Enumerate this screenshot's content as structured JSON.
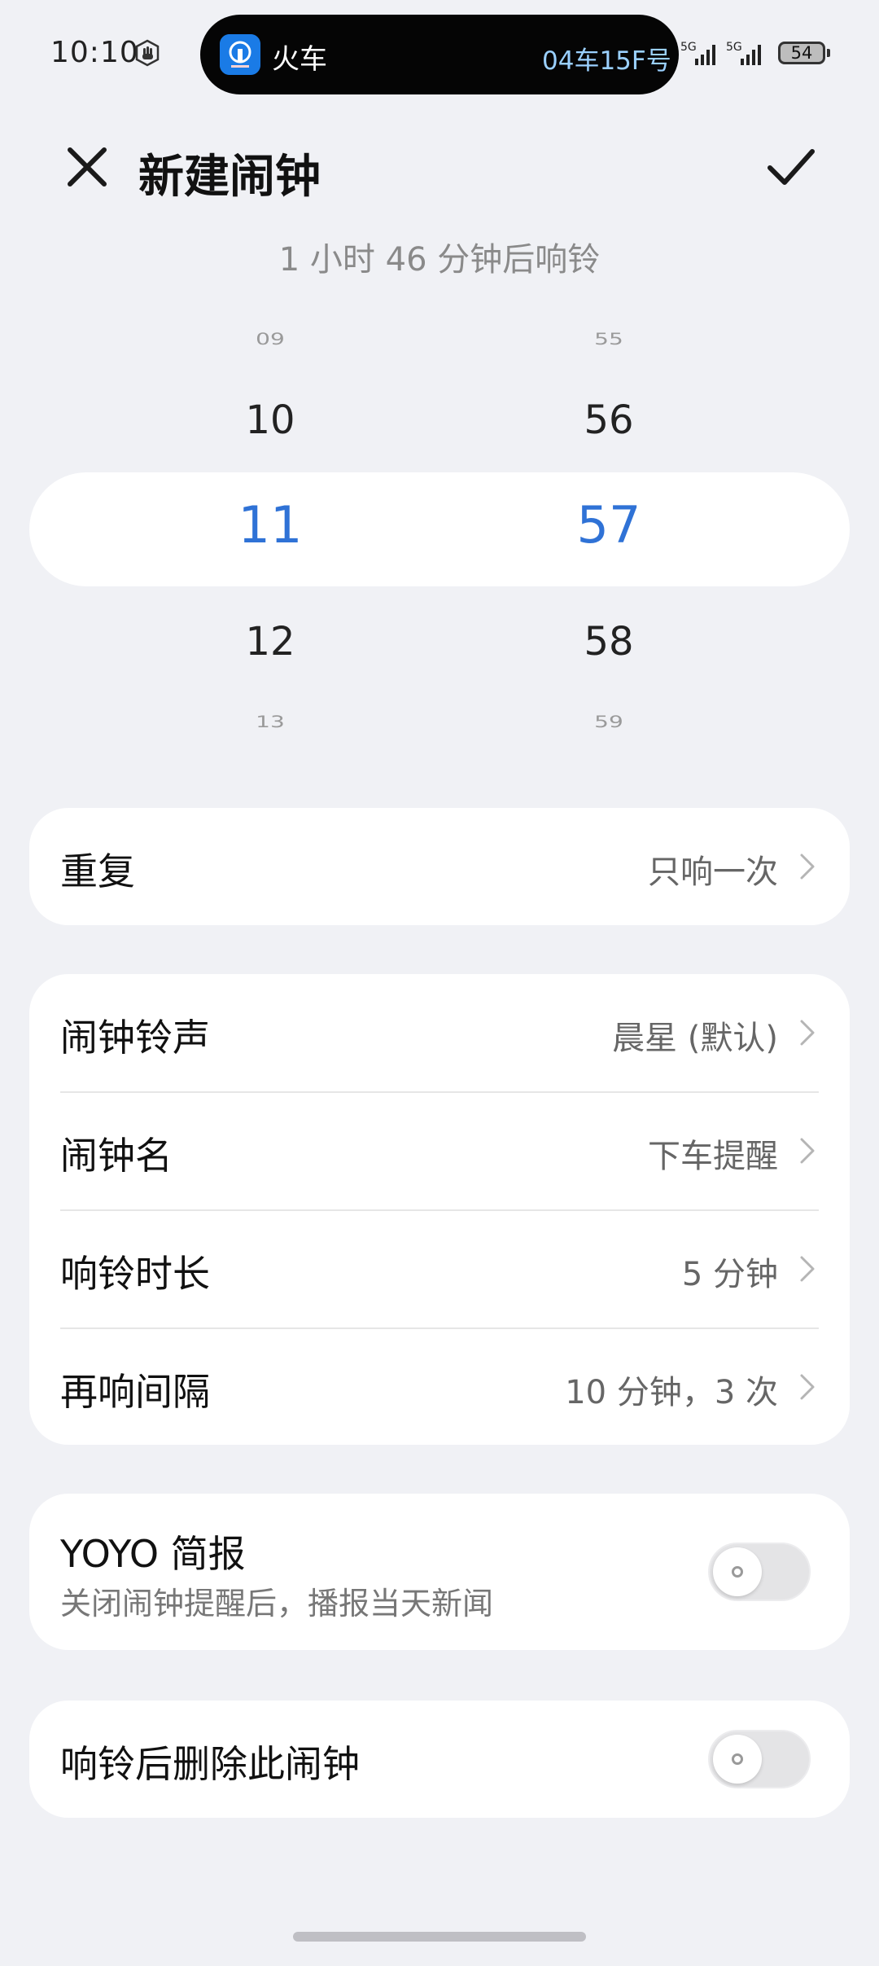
{
  "status_bar": {
    "time": "10:10",
    "island_label": "火车",
    "island_info": "04车15F号",
    "signal_1": "5G",
    "signal_2": "5G",
    "battery": "54"
  },
  "header": {
    "title": "新建闹钟"
  },
  "countdown": "1 小时 46 分钟后响铃",
  "picker": {
    "hours": [
      "09",
      "10",
      "11",
      "12",
      "13"
    ],
    "minutes": [
      "55",
      "56",
      "57",
      "58",
      "59"
    ],
    "selected_color": "#2f72d6"
  },
  "repeat": {
    "label": "重复",
    "value": "只响一次"
  },
  "settings": {
    "ringtone_label": "闹钟铃声",
    "ringtone_value": "晨星 (默认)",
    "name_label": "闹钟名",
    "name_value": "下车提醒",
    "duration_label": "响铃时长",
    "duration_value": "5 分钟",
    "snooze_label": "再响间隔",
    "snooze_value": "10 分钟，3 次"
  },
  "yoyo": {
    "label": "YOYO 简报",
    "description": "关闭闹钟提醒后，播报当天新闻",
    "enabled": false
  },
  "delete_after": {
    "label": "响铃后删除此闹钟",
    "enabled": false
  }
}
